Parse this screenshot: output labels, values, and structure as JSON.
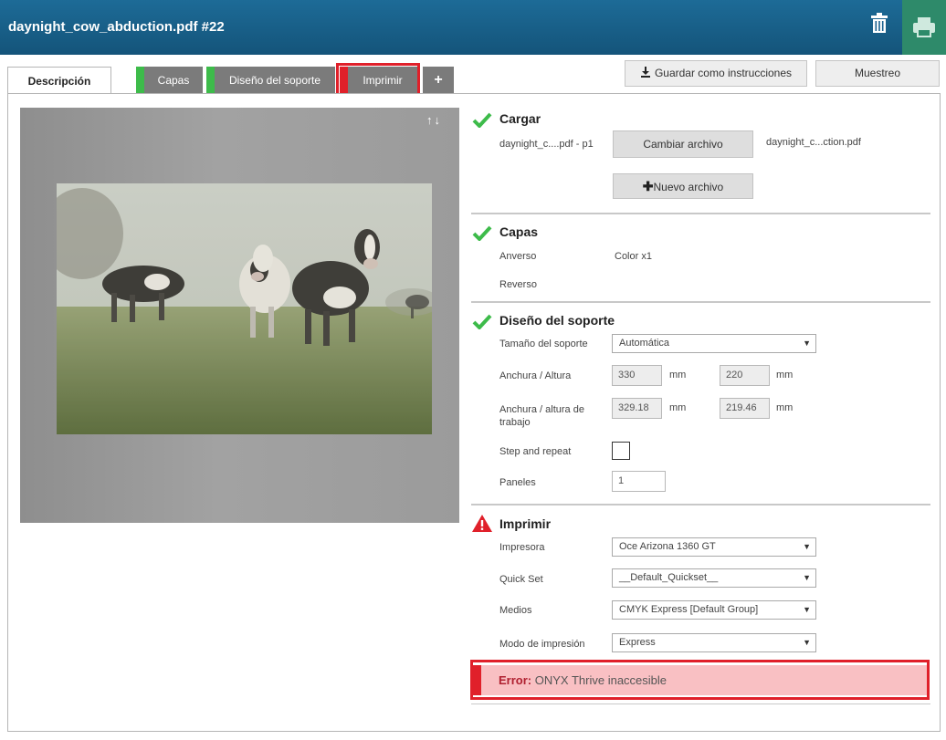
{
  "window": {
    "title": "daynight_cow_abduction.pdf #22"
  },
  "header_icons": {
    "trash": "trash-icon",
    "print": "printer-icon"
  },
  "tabs": [
    {
      "label": "Descripción",
      "active": true
    },
    {
      "label": "Capas",
      "status_color": "#3dbb4a"
    },
    {
      "label": "Diseño del soporte",
      "status_color": "#3dbb4a"
    },
    {
      "label": "Imprimir",
      "status_color": "#e0202a"
    },
    {
      "label": "+"
    }
  ],
  "toolbar": {
    "save_label": "Guardar como instrucciones",
    "sample_label": "Muestreo"
  },
  "preview": {
    "arrows": "↑↓"
  },
  "sections": {
    "cargar": {
      "title": "Cargar",
      "file_label": "daynight_c....pdf - p1",
      "change_button": "Cambiar archivo",
      "file_name": "daynight_c...ction.pdf",
      "new_button": "Nuevo archivo"
    },
    "capas": {
      "title": "Capas",
      "front_label": "Anverso",
      "front_value": "Color x1",
      "back_label": "Reverso"
    },
    "diseno": {
      "title": "Diseño del soporte",
      "size_label": "Tamaño del soporte",
      "size_value": "Automática",
      "wh_label": "Anchura / Altura",
      "width": "330",
      "height": "220",
      "unit": "mm",
      "job_wh_label": "Anchura / altura de trabajo",
      "job_width": "329.18",
      "job_height": "219.46",
      "step_label": "Step and repeat",
      "panels_label": "Paneles",
      "panels_value": "1"
    },
    "imprimir": {
      "title": "Imprimir",
      "printer_label": "Impresora",
      "printer_value": "Oce Arizona 1360 GT",
      "quickset_label": "Quick Set",
      "quickset_value": "__Default_Quickset__",
      "media_label": "Medios",
      "media_value": "CMYK Express [Default Group]",
      "mode_label": "Modo de impresión",
      "mode_value": "Express"
    }
  },
  "error": {
    "prefix": "Error:",
    "message": "ONYX Thrive inaccesible"
  },
  "colors": {
    "header": "#1a6290",
    "ok": "#3dbb4a",
    "error": "#e0202a",
    "error_bg": "#f9c0c3"
  }
}
